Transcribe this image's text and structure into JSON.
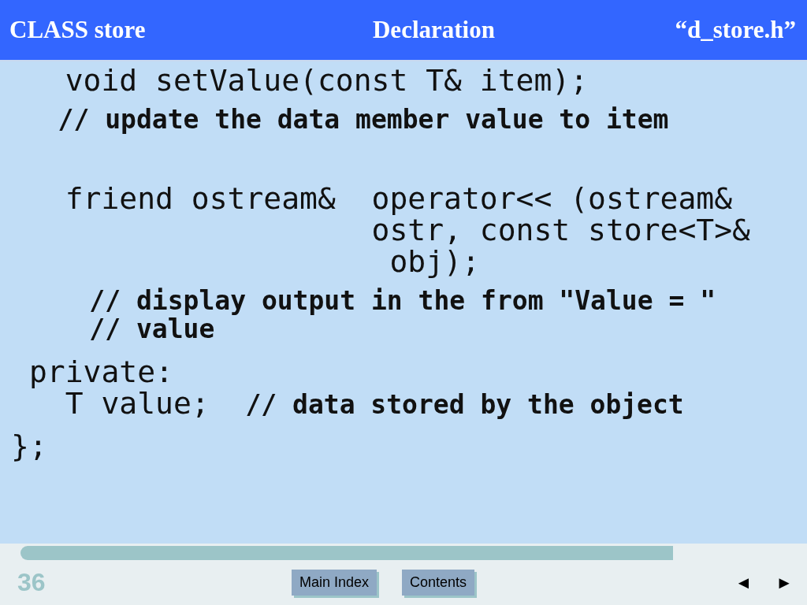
{
  "header": {
    "left": "CLASS store",
    "center": "Declaration",
    "right": "“d_store.h”"
  },
  "blocks": [
    [
      {
        "segments": [
          {
            "kind": "code",
            "text": "   void setValue(const T& item);"
          }
        ]
      },
      {
        "segments": [
          {
            "kind": "comment",
            "text": "   // update the data member value to item"
          }
        ]
      }
    ],
    [
      {
        "segments": [
          {
            "kind": "code",
            "text": "   friend ostream&  operator<< (ostream&"
          }
        ]
      },
      {
        "segments": [
          {
            "kind": "code",
            "text": "                    ostr, const store<T>&"
          }
        ]
      },
      {
        "segments": [
          {
            "kind": "code",
            "text": "                     obj);"
          }
        ]
      },
      {
        "segments": [
          {
            "kind": "comment",
            "text": "     // display output in the from \"Value = \""
          }
        ]
      },
      {
        "segments": [
          {
            "kind": "comment",
            "text": "     // value"
          }
        ]
      },
      {
        "segments": [
          {
            "kind": "code",
            "text": " private:"
          }
        ]
      },
      {
        "segments": [
          {
            "kind": "code",
            "text": "   T value;  "
          },
          {
            "kind": "comment",
            "text": "// data stored by the object"
          }
        ]
      },
      {
        "segments": [
          {
            "kind": "code",
            "text": "};"
          }
        ]
      }
    ]
  ],
  "footer": {
    "slide_number": "36",
    "buttons": [
      "Main Index",
      "Contents"
    ],
    "prev": "◄",
    "next": "►"
  }
}
